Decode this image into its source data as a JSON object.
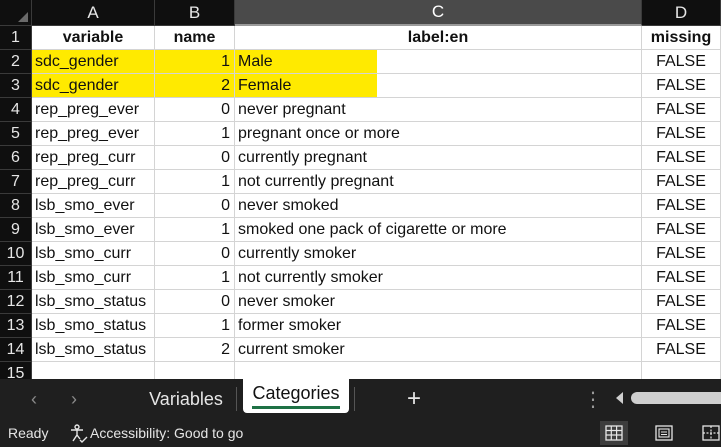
{
  "columns": [
    "A",
    "B",
    "C",
    "D"
  ],
  "selected_column": "C",
  "headers": [
    "variable",
    "name",
    "label:en",
    "missing"
  ],
  "rows": [
    {
      "num": "2",
      "variable": "sdc_gender",
      "name": "1",
      "label": "Male",
      "missing": "FALSE",
      "highlight": true
    },
    {
      "num": "3",
      "variable": "sdc_gender",
      "name": "2",
      "label": "Female",
      "missing": "FALSE",
      "highlight": true
    },
    {
      "num": "4",
      "variable": "rep_preg_ever",
      "name": "0",
      "label": "never pregnant",
      "missing": "FALSE"
    },
    {
      "num": "5",
      "variable": "rep_preg_ever",
      "name": "1",
      "label": "pregnant once or more",
      "missing": "FALSE"
    },
    {
      "num": "6",
      "variable": "rep_preg_curr",
      "name": "0",
      "label": "currently pregnant",
      "missing": "FALSE"
    },
    {
      "num": "7",
      "variable": "rep_preg_curr",
      "name": "1",
      "label": "not currently pregnant",
      "missing": "FALSE"
    },
    {
      "num": "8",
      "variable": "lsb_smo_ever",
      "name": "0",
      "label": "never smoked",
      "missing": "FALSE"
    },
    {
      "num": "9",
      "variable": "lsb_smo_ever",
      "name": "1",
      "label": "smoked one pack of cigarette or more",
      "missing": "FALSE"
    },
    {
      "num": "10",
      "variable": "lsb_smo_curr",
      "name": "0",
      "label": "currently smoker",
      "missing": "FALSE"
    },
    {
      "num": "11",
      "variable": "lsb_smo_curr",
      "name": "1",
      "label": "not currently smoker",
      "missing": "FALSE"
    },
    {
      "num": "12",
      "variable": "lsb_smo_status",
      "name": "0",
      "label": "never smoker",
      "missing": "FALSE"
    },
    {
      "num": "13",
      "variable": "lsb_smo_status",
      "name": "1",
      "label": "former smoker",
      "missing": "FALSE"
    },
    {
      "num": "14",
      "variable": "lsb_smo_status",
      "name": "2",
      "label": "current smoker",
      "missing": "FALSE"
    }
  ],
  "header_row_num": "1",
  "last_row_num": "15",
  "highlight_color": "#ffea00",
  "tabs": {
    "sheet1": "Variables",
    "sheet2": "Categories",
    "active": "Categories",
    "add_icon": "plus-icon",
    "more_icon": "more-horizontal-icon"
  },
  "status": {
    "ready": "Ready",
    "accessibility": "Accessibility: Good to go",
    "views": [
      "normal-view-icon",
      "page-layout-icon",
      "page-break-preview-icon"
    ]
  },
  "accent_color": "#1e7145"
}
